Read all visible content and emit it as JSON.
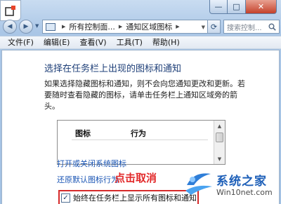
{
  "window": {
    "min_glyph": "—",
    "max_glyph": "□",
    "close_glyph": "✕"
  },
  "nav": {
    "crumbs": [
      "所有控制面...",
      "通知区域图标"
    ],
    "search_placeholder": "搜索控制..."
  },
  "menu": {
    "items": [
      "文件(F)",
      "编辑(E)",
      "查看(V)",
      "工具(T)",
      "帮助(H)"
    ]
  },
  "content": {
    "heading": "选择在任务栏上出现的图标和通知",
    "description": "如果选择隐藏图标和通知，则不会向您通知更改和更新。若要随时查看隐藏的图标，请单击任务栏上通知区域旁的箭头。",
    "table": {
      "columns": [
        "图标",
        "行为"
      ]
    },
    "system_icons_link": "打开或关闭系统图标",
    "restore_link": "还原默认图标行为",
    "callout": "点击取消",
    "checkbox": {
      "label": "始终在任务栏上显示所有图标和通知",
      "checked": true,
      "glyph": "✓"
    }
  },
  "watermark": {
    "title": "系统之家",
    "url": "Win10net.com"
  },
  "colors": {
    "heading": "#1e3f78",
    "link": "#1a55b4",
    "callout": "#e2292a",
    "highlight_border": "#d62a2a",
    "watermark_title": "#1d5fb8"
  }
}
